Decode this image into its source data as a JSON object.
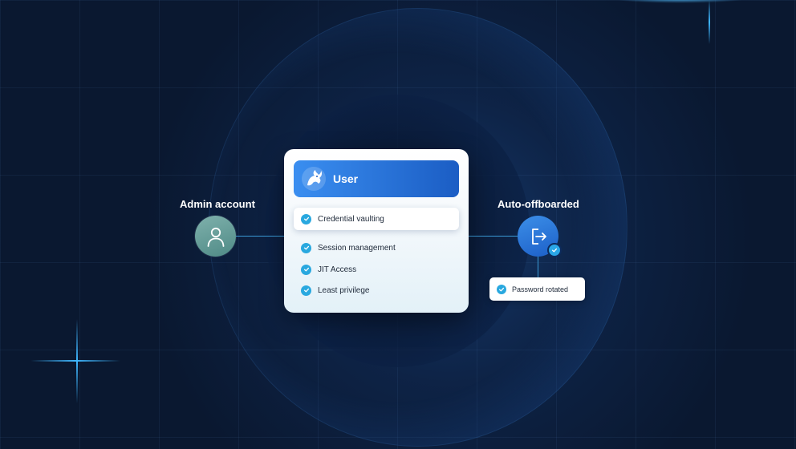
{
  "left_node": {
    "label": "Admin account",
    "icon": "person-icon"
  },
  "right_node": {
    "label": "Auto-offboarded",
    "icon": "logout-icon"
  },
  "card": {
    "title": "User",
    "logo": "dragon-logo",
    "items": [
      {
        "label": "Credential vaulting",
        "highlighted": true
      },
      {
        "label": "Session management",
        "highlighted": false
      },
      {
        "label": "JIT Access",
        "highlighted": false
      },
      {
        "label": "Least privilege",
        "highlighted": false
      }
    ]
  },
  "status_box": {
    "label": "Password rotated"
  },
  "colors": {
    "background": "#0a1830",
    "accent": "#29a8df",
    "header_start": "#3a8ef0",
    "header_end": "#1b5dc4",
    "avatar": "#5f9a95"
  }
}
